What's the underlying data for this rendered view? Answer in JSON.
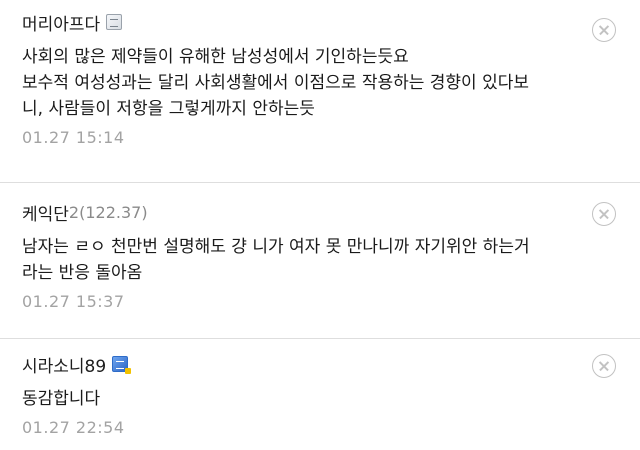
{
  "comments": [
    {
      "author": "머리아프다",
      "ip": "",
      "badge_icon": "memo-badge-icon",
      "lines": [
        "사회의 많은 제약들이 유해한 남성성에서 기인하는듯요",
        "보수적 여성성과는 달리 사회생활에서 이점으로 작용하는 경향이 있다보",
        "니, 사람들이 저항을 그렇게까지 안하는듯"
      ],
      "time": "01.27 15:14"
    },
    {
      "author": "케익단",
      "ip": "2(122.37)",
      "badge_icon": "",
      "lines": [
        "남자는 ㄹㅇ 천만번 설명해도 걍 니가 여자 못 만나니까 자기위안 하는거",
        "라는 반응 돌아옴"
      ],
      "time": "01.27 15:37"
    },
    {
      "author": "시라소니89",
      "ip": "",
      "badge_icon": "fixed-nick-badge-icon",
      "lines": [
        "동감합니다"
      ],
      "time": "01.27 22:54"
    }
  ],
  "delete_icon": "circle-x-icon",
  "colors": {
    "divider": "#dedede",
    "meta_text": "#a3a3a3",
    "ip_text": "#8a8a8a",
    "badge_blue": "#2c66c6"
  }
}
